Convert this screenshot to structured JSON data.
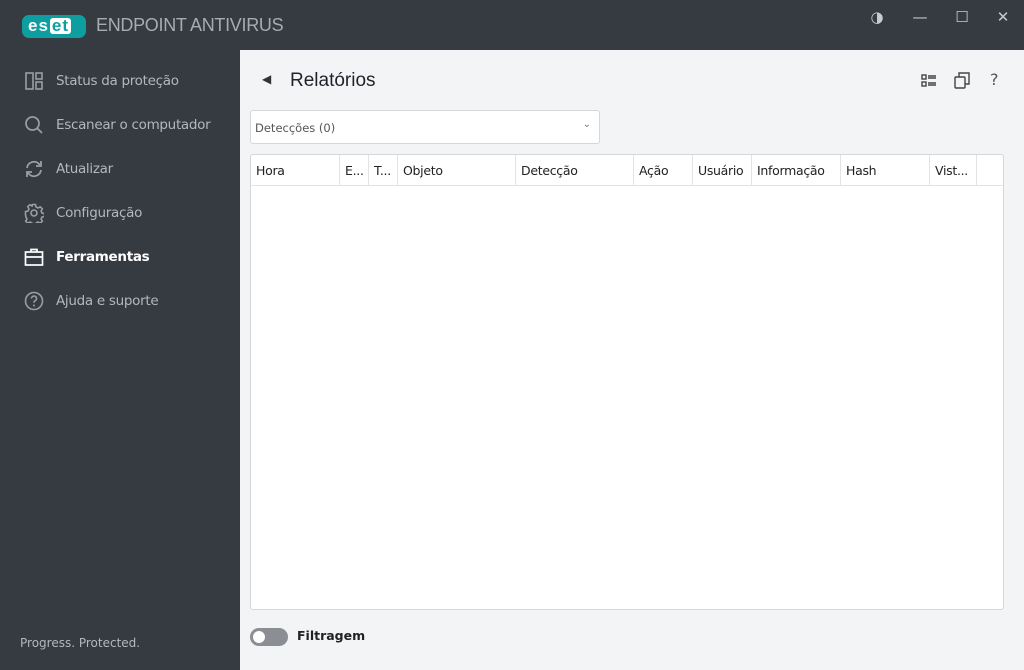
{
  "app": {
    "logo_text": "ESET",
    "product": "ENDPOINT ANTIVIRUS"
  },
  "window": {
    "theme": "◑",
    "minimize": "—",
    "maximize": "☐",
    "close": "✕"
  },
  "sidebar": {
    "items": [
      {
        "label": "Status da proteção",
        "icon": "dashboard-icon"
      },
      {
        "label": "Escanear o computador",
        "icon": "search-icon"
      },
      {
        "label": "Atualizar",
        "icon": "refresh-icon"
      },
      {
        "label": "Configuração",
        "icon": "gear-icon"
      },
      {
        "label": "Ferramentas",
        "icon": "toolbox-icon",
        "active": true
      },
      {
        "label": "Ajuda e suporte",
        "icon": "help-icon"
      }
    ],
    "tagline": "Progress. Protected."
  },
  "main": {
    "title": "Relatórios",
    "help": "?",
    "log_select": "Detecções (0)",
    "columns": [
      "Hora",
      "E...",
      "T...",
      "Objeto",
      "Detecção",
      "Ação",
      "Usuário",
      "Informação",
      "Hash",
      "Vist...",
      ""
    ],
    "filter_label": "Filtragem",
    "filter_on": false
  },
  "colors": {
    "accent": "#0e9ea0",
    "sidebar": "#363a41",
    "main": "#f3f4f6"
  }
}
